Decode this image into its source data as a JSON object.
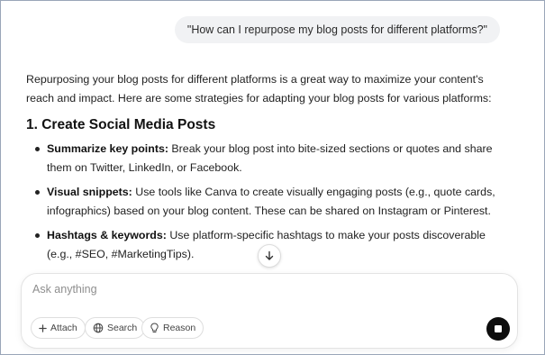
{
  "user_message": "\"How can I repurpose my blog posts for different platforms?\"",
  "answer": {
    "intro": "Repurposing your blog posts for different platforms is a great way to maximize your content's reach and impact. Here are some strategies for adapting your blog posts for various platforms:",
    "section_title": "1. Create Social Media Posts",
    "bullets": [
      {
        "term": "Summarize key points:",
        "text": " Break your blog post into bite-sized sections or quotes and share them on Twitter, LinkedIn, or Facebook."
      },
      {
        "term": "Visual snippets:",
        "text": " Use tools like Canva to create visually engaging posts (e.g., quote cards, infographics) based on your blog content. These can be shared on Instagram or Pinterest."
      },
      {
        "term": "Hashtags & keywords:",
        "text": " Use platform-specific hashtags to make your posts discoverable (e.g., #SEO, #MarketingTips)."
      }
    ]
  },
  "composer": {
    "placeholder": "Ask anything",
    "attach_label": "Attach",
    "search_label": "Search",
    "reason_label": "Reason"
  },
  "icons": {
    "scroll": "arrow-down-icon",
    "attach": "plus-icon",
    "search": "globe-icon",
    "reason": "lightbulb-icon",
    "send": "stop-icon"
  }
}
